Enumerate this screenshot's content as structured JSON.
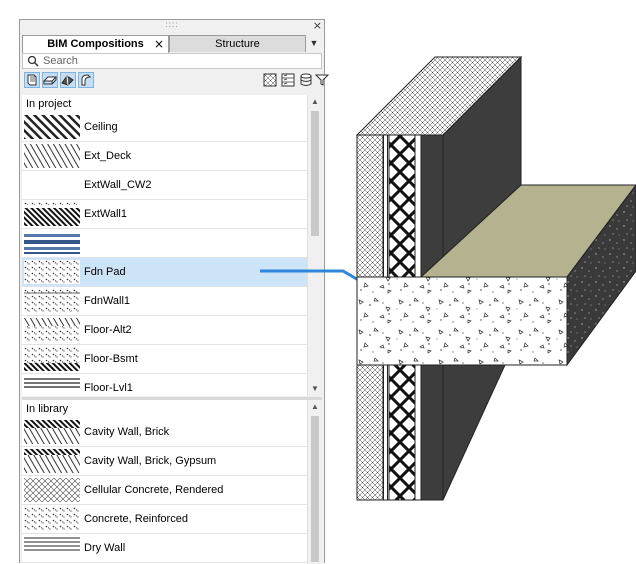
{
  "panel": {
    "grip": "::::",
    "close_glyph": "×",
    "tabs": [
      {
        "label": "BIM Compositions",
        "close_glyph": "×"
      },
      {
        "label": "Structure"
      }
    ],
    "tab_menu_glyph": "▼",
    "search_placeholder": "Search",
    "toolbar_left": [
      "walls-filter-icon",
      "slabs-filter-icon",
      "roofs-filter-icon",
      "shells-filter-icon"
    ],
    "toolbar_right": [
      "hatch-view-icon",
      "list-view-icon",
      "database-icon",
      "filter-icon"
    ]
  },
  "in_project": {
    "header": "In project",
    "items": [
      {
        "label": "Ceiling",
        "pattern": "diag-heavy"
      },
      {
        "label": "Ext_Deck",
        "pattern": "diag-light"
      },
      {
        "label": "ExtWall_CW2",
        "pattern": "blank"
      },
      {
        "label": "ExtWall1",
        "pattern": "diag-dense"
      },
      {
        "label": "",
        "pattern": "blue-layers"
      },
      {
        "label": "Fdn Pad",
        "pattern": "concrete",
        "selected": true
      },
      {
        "label": "FdnWall1",
        "pattern": "concrete-lined"
      },
      {
        "label": "Floor-Alt2",
        "pattern": "diag-dots"
      },
      {
        "label": "Floor-Bsmt",
        "pattern": "dots-stripes"
      },
      {
        "label": "Floor-Lvl1",
        "pattern": "stripes"
      }
    ]
  },
  "in_library": {
    "header": "In library",
    "items": [
      {
        "label": "Cavity Wall, Brick",
        "pattern": "brick"
      },
      {
        "label": "Cavity Wall, Brick, Gypsum",
        "pattern": "brick-gyp"
      },
      {
        "label": "Cellular Concrete, Rendered",
        "pattern": "cross"
      },
      {
        "label": "Concrete, Reinforced",
        "pattern": "concrete"
      },
      {
        "label": "Dry Wall",
        "pattern": "lines"
      }
    ]
  },
  "scroll_arrows": {
    "up": "▲",
    "down": "▼"
  },
  "colors": {
    "selection": "#cde3f8",
    "callout": "#2e86de",
    "slab_top": "#b5b28f",
    "wall_dark": "#3d3d3d"
  }
}
